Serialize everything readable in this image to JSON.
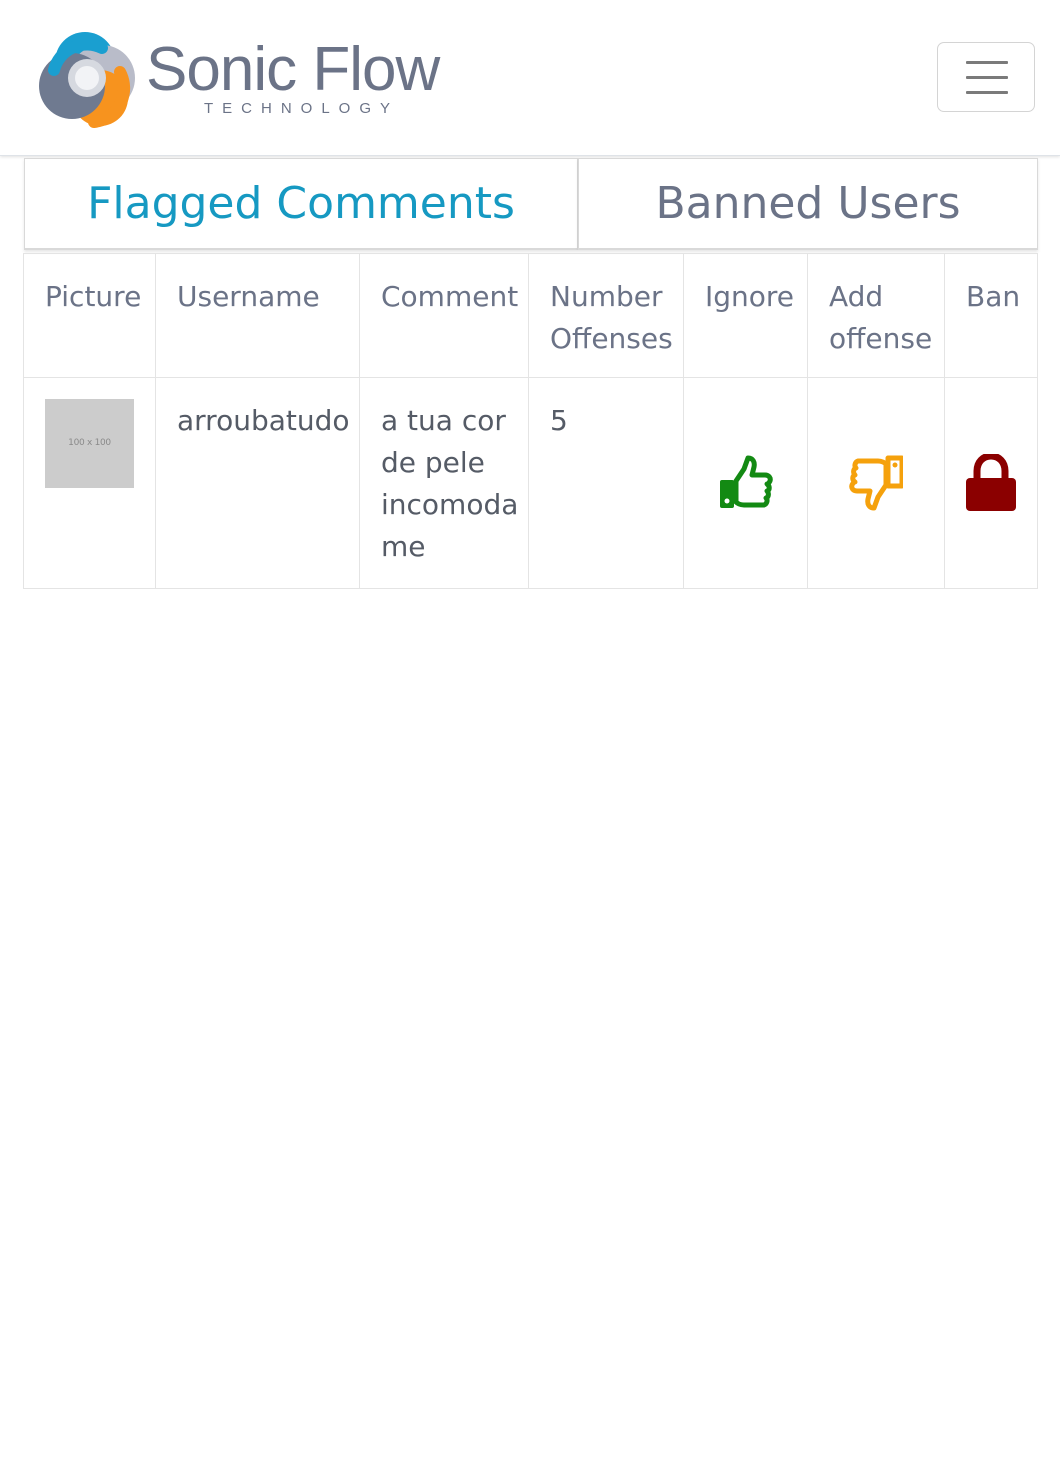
{
  "brand": {
    "name": "Sonic Flow",
    "subtitle": "TECHNOLOGY"
  },
  "colors": {
    "accent": "#1699c2",
    "muted_text": "#6b7387",
    "ignore": "#138a13",
    "add_offense": "#f5a10c",
    "ban": "#8b0000",
    "logo_blue": "#1a9fd0",
    "logo_orange": "#f7931e",
    "logo_slate": "#6f7a90",
    "logo_light": "#b9bcc9"
  },
  "tabs": [
    {
      "label": "Flagged Comments",
      "active": true
    },
    {
      "label": "Banned Users",
      "active": false
    }
  ],
  "table": {
    "headers": [
      "Picture",
      "Username",
      "Comment",
      "Number Offenses",
      "Ignore",
      "Add offense",
      "Ban"
    ],
    "rows": [
      {
        "picture_placeholder": "100 x 100",
        "username": "arroubatudo",
        "comment": "a tua cor de pele incomoda me",
        "offenses": "5",
        "ignore_icon": "thumbs-up-icon",
        "add_offense_icon": "thumbs-down-icon",
        "ban_icon": "lock-icon"
      }
    ]
  }
}
